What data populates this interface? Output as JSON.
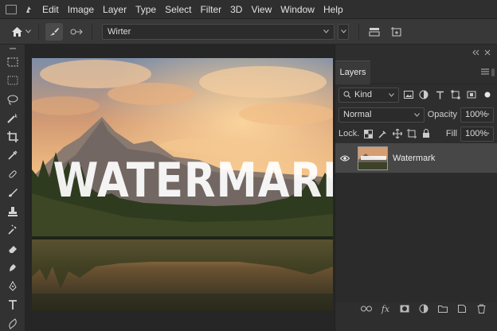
{
  "menubar": {
    "items": [
      "Edit",
      "Image",
      "Layer",
      "Type",
      "Select",
      "Filter",
      "3D",
      "View",
      "Window",
      "Help"
    ]
  },
  "options": {
    "font_family": "Wirter"
  },
  "tools": [
    "marquee-rect-icon",
    "marquee-dashed-icon",
    "lasso-icon",
    "magic-wand-icon",
    "crop-icon",
    "eyedropper-icon",
    "healing-brush-icon",
    "brush-icon",
    "stamp-icon",
    "history-brush-icon",
    "eraser-icon",
    "gradient-icon",
    "pen-icon",
    "type-icon",
    "path-select-icon"
  ],
  "canvas": {
    "watermark_text": "WATERMARK"
  },
  "layers_panel": {
    "tab_label": "Layers",
    "filter_kind": "Kind",
    "blend_mode": "Normal",
    "opacity_label": "Opacity",
    "opacity_value": "100%",
    "lock_label": "Lock.",
    "fill_label": "Fill",
    "fill_value": "100%",
    "layers": [
      {
        "name": "Watermark",
        "visible": true
      }
    ]
  },
  "colors": {
    "ui_bg": "#2b2b2b",
    "selected_layer": "#474747",
    "sky_top": "#6f86a3",
    "sky_glow": "#f2b878"
  }
}
